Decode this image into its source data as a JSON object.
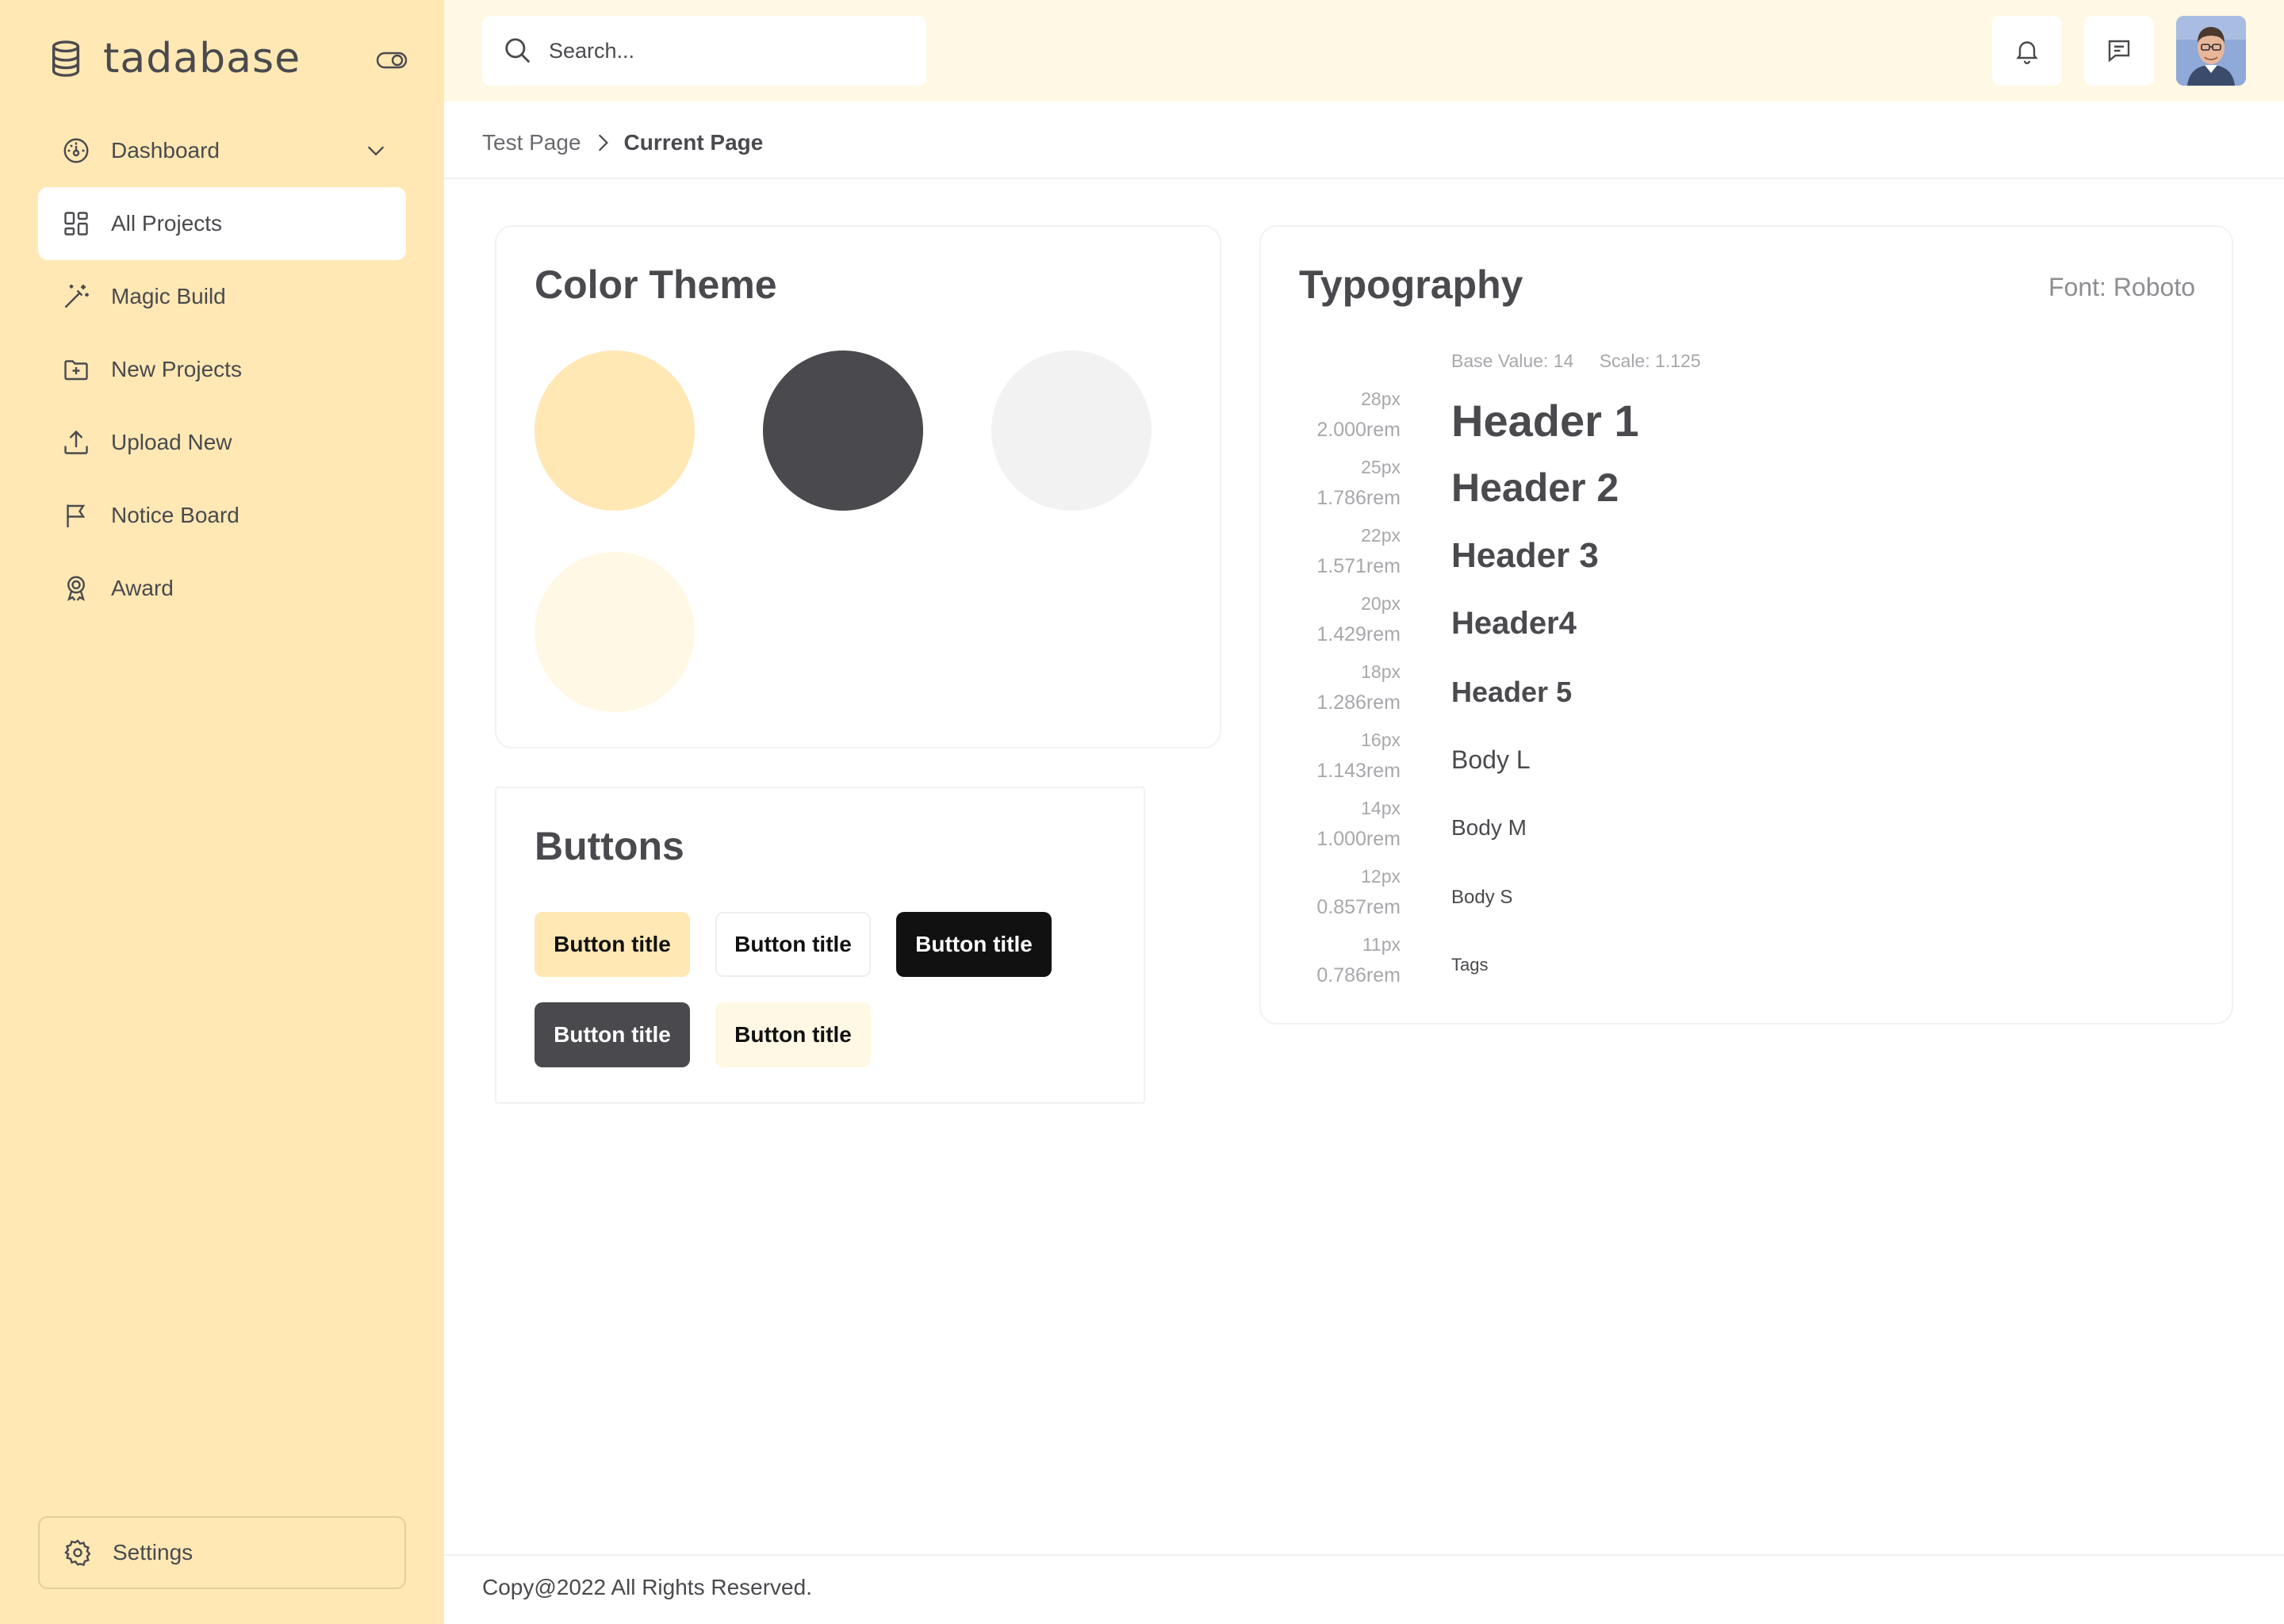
{
  "brand": {
    "name": "tadabase"
  },
  "sidebar": {
    "items": [
      {
        "label": "Dashboard",
        "icon": "dashboard-gauge-icon",
        "has_chevron": true
      },
      {
        "label": "All Projects",
        "icon": "grid-icon",
        "active": true
      },
      {
        "label": "Magic Build",
        "icon": "magic-wand-icon"
      },
      {
        "label": "New Projects",
        "icon": "folder-plus-icon"
      },
      {
        "label": "Upload New",
        "icon": "upload-icon"
      },
      {
        "label": "Notice Board",
        "icon": "flag-icon"
      },
      {
        "label": "Award",
        "icon": "award-icon"
      }
    ],
    "settings_label": "Settings"
  },
  "topbar": {
    "search_placeholder": "Search..."
  },
  "breadcrumb": {
    "parent": "Test Page",
    "current": "Current Page"
  },
  "color_theme": {
    "title": "Color Theme",
    "swatches": [
      "#FFE8B4",
      "#4A4A4E",
      "#F2F2F2",
      "#FFF8E4"
    ]
  },
  "buttons": {
    "title": "Buttons",
    "items": [
      {
        "label": "Button title",
        "bg": "#FFE8B4",
        "fg": "#111111"
      },
      {
        "label": "Button title",
        "bg": "#FFFFFF",
        "fg": "#111111"
      },
      {
        "label": "Button title",
        "bg": "#111111",
        "fg": "#FFFFFF"
      },
      {
        "label": "Button title",
        "bg": "#4A4A4E",
        "fg": "#FFFFFF"
      },
      {
        "label": "Button title",
        "bg": "#FFF8E4",
        "fg": "#111111"
      }
    ]
  },
  "typography": {
    "title": "Typography",
    "font_label": "Font: Roboto",
    "base_value": "Base Value: 14",
    "scale": "Scale: 1.125",
    "rows": [
      {
        "px": "28px",
        "rem": "2.000rem",
        "sample": "Header 1"
      },
      {
        "px": "25px",
        "rem": "1.786rem",
        "sample": "Header 2"
      },
      {
        "px": "22px",
        "rem": "1.571rem",
        "sample": "Header 3"
      },
      {
        "px": "20px",
        "rem": "1.429rem",
        "sample": "Header4"
      },
      {
        "px": "18px",
        "rem": "1.286rem",
        "sample": "Header 5"
      },
      {
        "px": "16px",
        "rem": "1.143rem",
        "sample": "Body L"
      },
      {
        "px": "14px",
        "rem": "1.000rem",
        "sample": "Body M"
      },
      {
        "px": "12px",
        "rem": "0.857rem",
        "sample": "Body S"
      },
      {
        "px": "11px",
        "rem": "0.786rem",
        "sample": "Tags"
      }
    ]
  },
  "footer": {
    "text": "Copy@2022 All Rights Reserved."
  }
}
